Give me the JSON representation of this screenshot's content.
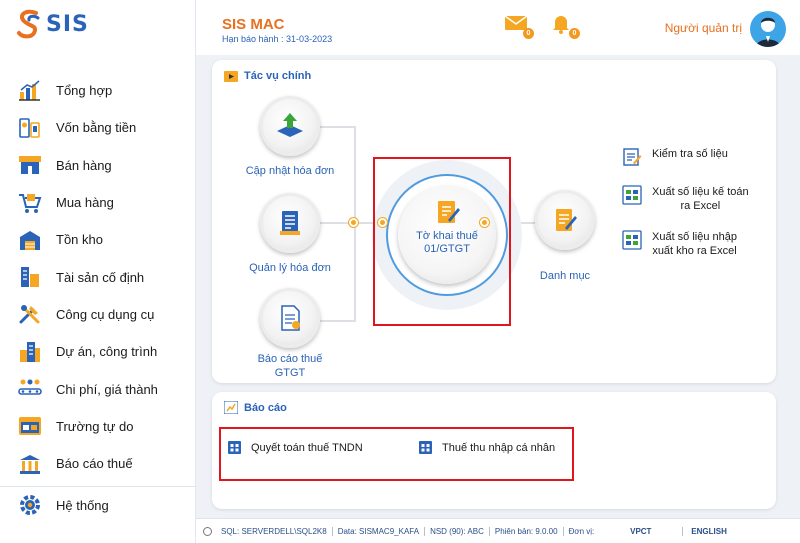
{
  "logo": {
    "text": "SIS"
  },
  "header": {
    "title": "SIS MAC",
    "subtitle": "Hạn báo hành : 31-03-2023",
    "mail_badge": "0",
    "bell_badge": "0",
    "user_name": "Người quản trị"
  },
  "sidebar": {
    "items": [
      {
        "label": "Tổng hợp",
        "icon": "bar-chart-icon"
      },
      {
        "label": "Vốn bằng tiền",
        "icon": "money-icon"
      },
      {
        "label": "Bán hàng",
        "icon": "store-icon"
      },
      {
        "label": "Mua hàng",
        "icon": "cart-icon"
      },
      {
        "label": "Tồn kho",
        "icon": "warehouse-icon"
      },
      {
        "label": "Tài sản cố định",
        "icon": "asset-icon"
      },
      {
        "label": "Công cụ dụng cụ",
        "icon": "tools-icon"
      },
      {
        "label": "Dự án, công trình",
        "icon": "building-icon"
      },
      {
        "label": "Chi phí, giá thành",
        "icon": "cost-icon"
      },
      {
        "label": "Trường tự do",
        "icon": "fields-icon"
      },
      {
        "label": "Báo cáo thuế",
        "icon": "tax-report-icon"
      },
      {
        "label": "Hệ thống",
        "icon": "gear-icon"
      }
    ]
  },
  "main_tasks": {
    "title": "Tác vụ chính",
    "ops": [
      {
        "label": "Cập nhật hóa đơn"
      },
      {
        "label": "Quản lý hóa đơn"
      },
      {
        "label": "Báo cáo thuế\nGTGT"
      }
    ],
    "center": {
      "label": "Tờ khai thuế\n01/GTGT"
    },
    "catalog": {
      "label": "Danh mục"
    },
    "links": [
      {
        "label": "Kiểm tra số liệu"
      },
      {
        "label": "Xuất số liệu kế toán\nra Excel"
      },
      {
        "label": "Xuất số liệu nhập\nxuất kho ra Excel"
      }
    ]
  },
  "reports": {
    "title": "Báo cáo",
    "items": [
      {
        "label": "Quyết toán thuế TNDN"
      },
      {
        "label": "Thuế thu nhập cá nhân"
      }
    ]
  },
  "status": {
    "sql": "SQL: SERVERDELL\\SQL2K8",
    "data": "Data: SISMAC9_KAFA",
    "nsd": "NSD (90): ABC",
    "version": "Phiên bản: 9.0.00",
    "unit_label": "Đơn vị:",
    "unit_value": "VPCT",
    "language": "ENGLISH"
  },
  "colors": {
    "accent_orange": "#e8701f",
    "accent_blue": "#2a63b7",
    "highlight_red": "#e0161e"
  }
}
